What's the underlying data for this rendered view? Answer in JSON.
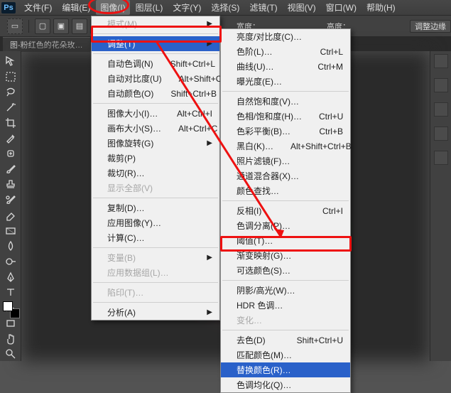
{
  "menubar": {
    "logo": "Ps",
    "items": [
      {
        "label": "文件(F)"
      },
      {
        "label": "编辑(E)"
      },
      {
        "label": "图像(I)",
        "active": true
      },
      {
        "label": "图层(L)"
      },
      {
        "label": "文字(Y)"
      },
      {
        "label": "选择(S)"
      },
      {
        "label": "滤镜(T)"
      },
      {
        "label": "视图(V)"
      },
      {
        "label": "窗口(W)"
      },
      {
        "label": "帮助(H)"
      }
    ]
  },
  "optionsbar": {
    "width_label": "宽度：",
    "height_label": "高度：",
    "trailing_btn": "调整边缘"
  },
  "doc_tab": {
    "label": "图-粉红色的花朵玫…"
  },
  "image_menu": {
    "mode": {
      "label": "模式(M)",
      "has_sub": true,
      "disabled": true
    },
    "adjust": {
      "label": "调整(T)",
      "has_sub": true,
      "highlight": true
    },
    "auto_tone": {
      "label": "自动色调(N)",
      "shortcut": "Shift+Ctrl+L"
    },
    "auto_contrast": {
      "label": "自动对比度(U)",
      "shortcut": "Alt+Shift+Ctrl+L"
    },
    "auto_color": {
      "label": "自动颜色(O)",
      "shortcut": "Shift+Ctrl+B"
    },
    "img_size": {
      "label": "图像大小(I)…",
      "shortcut": "Alt+Ctrl+I"
    },
    "canvas_size": {
      "label": "画布大小(S)…",
      "shortcut": "Alt+Ctrl+C"
    },
    "rotate": {
      "label": "图像旋转(G)",
      "has_sub": true
    },
    "crop": {
      "label": "裁剪(P)"
    },
    "trim": {
      "label": "裁切(R)…"
    },
    "reveal": {
      "label": "显示全部(V)",
      "disabled": true
    },
    "duplicate": {
      "label": "复制(D)…"
    },
    "apply_img": {
      "label": "应用图像(Y)…"
    },
    "calc": {
      "label": "计算(C)…"
    },
    "variables": {
      "label": "变量(B)",
      "has_sub": true,
      "disabled": true
    },
    "datasets": {
      "label": "应用数据组(L)…",
      "disabled": true
    },
    "trap": {
      "label": "陷印(T)…",
      "disabled": true
    },
    "analysis": {
      "label": "分析(A)",
      "has_sub": true
    }
  },
  "adjust_menu": {
    "bri_con": {
      "label": "亮度/对比度(C)…"
    },
    "levels": {
      "label": "色阶(L)…",
      "shortcut": "Ctrl+L"
    },
    "curves": {
      "label": "曲线(U)…",
      "shortcut": "Ctrl+M"
    },
    "exposure": {
      "label": "曝光度(E)…"
    },
    "vibrance": {
      "label": "自然饱和度(V)…"
    },
    "hue_sat": {
      "label": "色相/饱和度(H)…",
      "shortcut": "Ctrl+U"
    },
    "color_bal": {
      "label": "色彩平衡(B)…",
      "shortcut": "Ctrl+B"
    },
    "bw": {
      "label": "黑白(K)…",
      "shortcut": "Alt+Shift+Ctrl+B"
    },
    "photo_filt": {
      "label": "照片滤镜(F)…"
    },
    "chan_mix": {
      "label": "通道混合器(X)…"
    },
    "color_look": {
      "label": "颜色查找…"
    },
    "invert": {
      "label": "反相(I)",
      "shortcut": "Ctrl+I"
    },
    "posterize": {
      "label": "色调分离(P)…"
    },
    "threshold": {
      "label": "阈值(T)…"
    },
    "grad_map": {
      "label": "渐变映射(G)…"
    },
    "sel_color": {
      "label": "可选颜色(S)…"
    },
    "shadow_hl": {
      "label": "阴影/高光(W)…"
    },
    "hdr_tone": {
      "label": "HDR 色调…"
    },
    "variations": {
      "label": "变化…",
      "disabled": true
    },
    "desat": {
      "label": "去色(D)",
      "shortcut": "Shift+Ctrl+U"
    },
    "match_color": {
      "label": "匹配颜色(M)…"
    },
    "replace_col": {
      "label": "替换颜色(R)…",
      "highlight": true
    },
    "equalize": {
      "label": "色调均化(Q)…"
    }
  },
  "annotation": {
    "oval_target": "图像(I)",
    "rect1_target": "调整(T)",
    "rect2_target": "替换颜色(R)…"
  }
}
